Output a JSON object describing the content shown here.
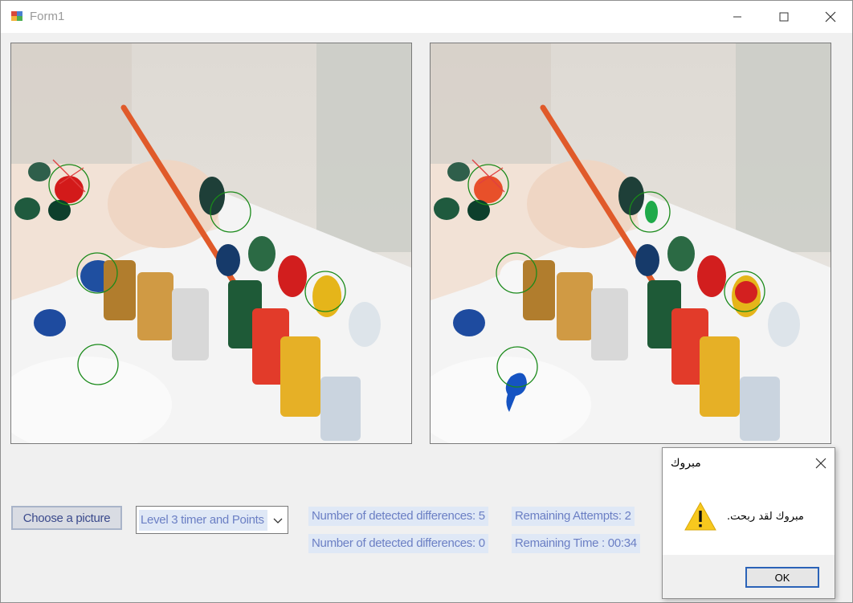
{
  "window": {
    "title": "Form1"
  },
  "controls": {
    "choose_button_label": "Choose a picture",
    "level_select_value": "Level 3 timer and Points",
    "detected_left": "Number of detected differences: 5",
    "detected_right": "Number of detected differences: 0",
    "remaining_attempts": "Remaining Attempts: 2",
    "remaining_time": "Remaining Time : 00:34"
  },
  "dialog": {
    "title": "مبروك",
    "message": "مبروك لقد ربحت.",
    "ok_label": "OK",
    "icon": "warning-icon"
  },
  "colors": {
    "label_bg": "#dfe8f6",
    "label_text": "#6b7fc4",
    "circle": "#1a8a1a"
  }
}
